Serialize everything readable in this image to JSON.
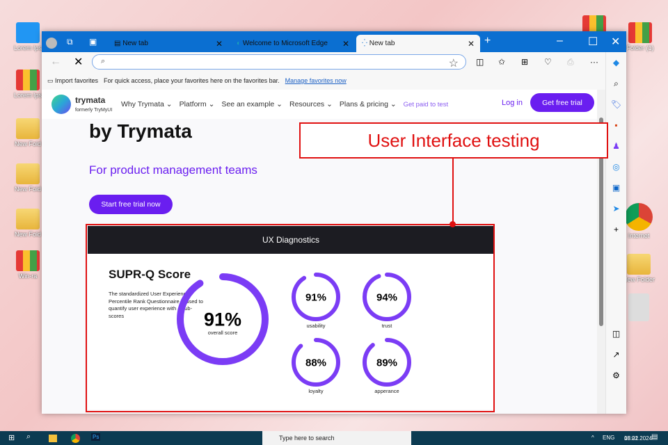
{
  "desktop": {
    "left_icons": [
      "Lorem Ips",
      "Lorem Ips",
      "New Fold",
      "New Fold",
      "New Fold",
      "Win-ra"
    ],
    "right_icons": [
      "Folder (1)",
      "Internet",
      "New Folder"
    ]
  },
  "browser": {
    "tabs": [
      {
        "label": "New tab"
      },
      {
        "label": "Welcome to Microsoft Edge"
      },
      {
        "label": "New tab"
      }
    ],
    "address_value": "",
    "favorites": {
      "import": "Import favorites",
      "hint": "For quick access, place your favorites here on the favorites bar.",
      "manage": "Manage favorites now"
    }
  },
  "site": {
    "logo": "trymata",
    "logo_sub": "formerly TryMyUI",
    "nav": [
      "Why Trymata",
      "Platform",
      "See an example",
      "Resources",
      "Plans & pricing"
    ],
    "paid": "Get paid to test",
    "login": "Log in",
    "cta": "Get free trial",
    "hero_title": "by Trymata",
    "hero_sub": "For product management teams",
    "hero_btn": "Start free trial now",
    "panel_title": "UX Diagnostics",
    "score_title": "SUPR-Q Score",
    "score_desc": "The standardized User Experience Percentile Rank Questionnaire is used to quantify user experience with 4 sub-scores",
    "overall": {
      "value": "91%",
      "label": "overall score",
      "pct": 91
    },
    "subs": [
      {
        "value": "91%",
        "label": "usability",
        "pct": 91
      },
      {
        "value": "94%",
        "label": "trust",
        "pct": 94
      },
      {
        "value": "88%",
        "label": "loyalty",
        "pct": 88
      },
      {
        "value": "89%",
        "label": "apperance",
        "pct": 89
      }
    ]
  },
  "annotation": "User Interface testing",
  "taskbar": {
    "search": "Type here to search",
    "lang": "ENG",
    "time": "15:21",
    "date": "08.02.2024"
  },
  "colors": {
    "accent": "#6a1ef0",
    "ring": "#7b3cf5",
    "annotation": "#e01010",
    "tabbar": "#0b6fd1"
  }
}
